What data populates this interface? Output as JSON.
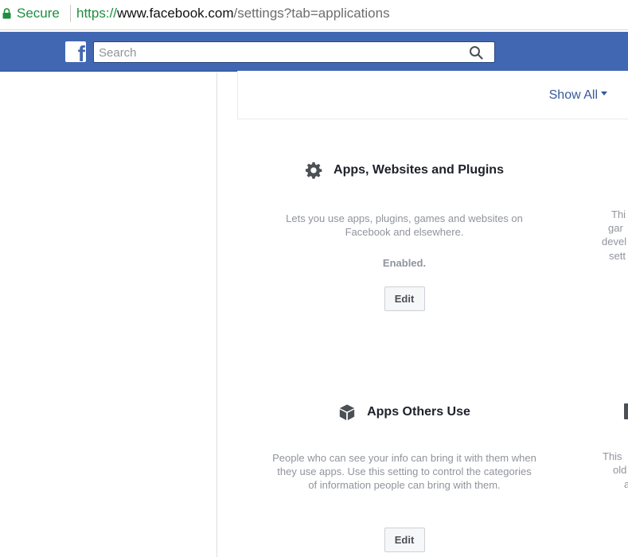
{
  "browser": {
    "secure_label": "Secure",
    "url_scheme": "https://",
    "url_host": "www.facebook.com",
    "url_path": "/settings?tab=applications",
    "secure_color": "#1e8e3e"
  },
  "topbar": {
    "search_placeholder": "Search",
    "logo_letter": "f",
    "bar_color": "#4267b2"
  },
  "main": {
    "show_all_label": "Show All",
    "settings": [
      {
        "icon": "gear-icon",
        "title": "Apps, Websites and Plugins",
        "description": "Lets you use apps, plugins, games and websites on Facebook and elsewhere.",
        "status": "Enabled.",
        "edit_label": "Edit"
      },
      {
        "icon": "box-icon",
        "title": "Apps Others Use",
        "description": "People who can see your info can bring it with them when they use apps. Use this setting to control the categories of information people can bring with them.",
        "edit_label": "Edit"
      }
    ],
    "peek_right_1": [
      "Thi",
      "gar",
      "devel",
      "sett"
    ],
    "peek_right_2": [
      "This",
      "old",
      "a"
    ]
  }
}
